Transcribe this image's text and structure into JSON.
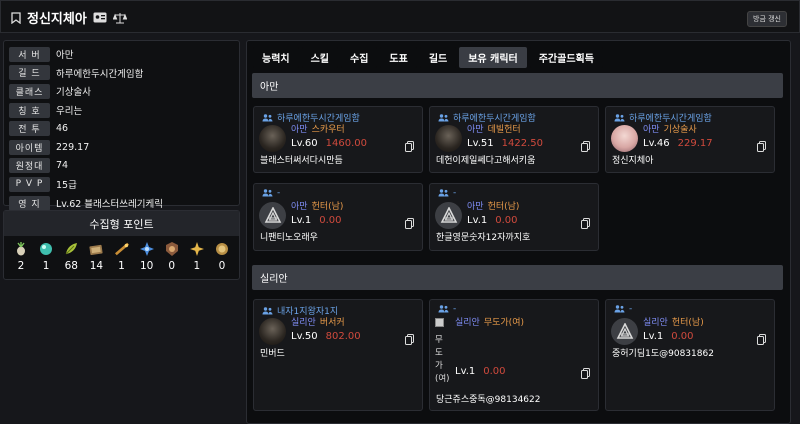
{
  "header": {
    "title": "정신지체아",
    "refresh_label": "방금 갱신"
  },
  "profile": {
    "rows": [
      {
        "label": "서 버",
        "value": "아만"
      },
      {
        "label": "길 드",
        "value": "하루에한두시간게임함"
      },
      {
        "label": "클래스",
        "value": "기상술사"
      },
      {
        "label": "칭 호",
        "value": "우리는"
      },
      {
        "label": "전 투",
        "value": "46"
      },
      {
        "label": "아이템",
        "value": "229.17"
      },
      {
        "label": "원정대",
        "value": "74"
      },
      {
        "label": "P V P",
        "value": "15급"
      },
      {
        "label": "영 지",
        "value": "Lv.62 블래스터쓰레기케릭"
      }
    ]
  },
  "collection": {
    "title": "수집형 포인트",
    "items": [
      {
        "icon": "mokoko-seed-icon",
        "value": "2"
      },
      {
        "icon": "island-heart-icon",
        "value": "1"
      },
      {
        "icon": "world-tree-leaf-icon",
        "value": "68"
      },
      {
        "icon": "adventure-tome-icon",
        "value": "14"
      },
      {
        "icon": "great-art-icon",
        "value": "1"
      },
      {
        "icon": "ignea-token-icon",
        "value": "10"
      },
      {
        "icon": "voyage-icon",
        "value": "0"
      },
      {
        "icon": "orpheus-star-icon",
        "value": "1"
      },
      {
        "icon": "omnium-seed-icon",
        "value": "0"
      }
    ]
  },
  "tabs": [
    "능력치",
    "스킬",
    "수집",
    "도표",
    "길드",
    "보유 캐릭터",
    "주간골드획득"
  ],
  "active_tab": "보유 캐릭터",
  "sections": [
    {
      "server": "아만",
      "characters": [
        {
          "guild": "하루에한두시간게임함",
          "server": "아만",
          "class": "스카우터",
          "level": "Lv.60",
          "item_level": "1460.00",
          "name": "블래스터써서다시만듬",
          "avatar": "photo"
        },
        {
          "guild": "하루에한두시간게임함",
          "server": "아만",
          "class": "데빌헌터",
          "level": "Lv.51",
          "item_level": "1422.50",
          "name": "데헌이제일쎄다고해서키움",
          "avatar": "photo"
        },
        {
          "guild": "하루에한두시간게임함",
          "server": "아만",
          "class": "기상술사",
          "level": "Lv.46",
          "item_level": "229.17",
          "name": "정신지체아",
          "avatar": "photo-pink"
        },
        {
          "guild": "-",
          "server": "아만",
          "class": "헌터(남)",
          "level": "Lv.1",
          "item_level": "0.00",
          "name": "니팬티노오래우",
          "avatar": "emblem"
        },
        {
          "guild": "-",
          "server": "아만",
          "class": "헌터(남)",
          "level": "Lv.1",
          "item_level": "0.00",
          "name": "한글영문숫자12자까지호",
          "avatar": "emblem"
        }
      ]
    },
    {
      "server": "실리안",
      "characters": [
        {
          "guild": "내자1지왕자1지",
          "server": "실리안",
          "class": "버서커",
          "level": "Lv.50",
          "item_level": "802.00",
          "name": "민버드",
          "avatar": "photo"
        },
        {
          "guild": "-",
          "server": "실리안",
          "class": "무도가(여)",
          "level": "Lv.1",
          "item_level": "0.00",
          "name": "당근쥬스중독@98134622",
          "avatar": "broken",
          "alt_text": "무도가(여)"
        },
        {
          "guild": "-",
          "server": "실리안",
          "class": "헌터(남)",
          "level": "Lv.1",
          "item_level": "0.00",
          "name": "중허기딤1도@90831862",
          "avatar": "emblem"
        }
      ]
    }
  ],
  "colors": {
    "background": "#16171b",
    "guild_text": "#6aa2e6",
    "server_text": "#7f8df5",
    "class_text": "#e79a4a",
    "item_level_text": "#d04a3d"
  }
}
